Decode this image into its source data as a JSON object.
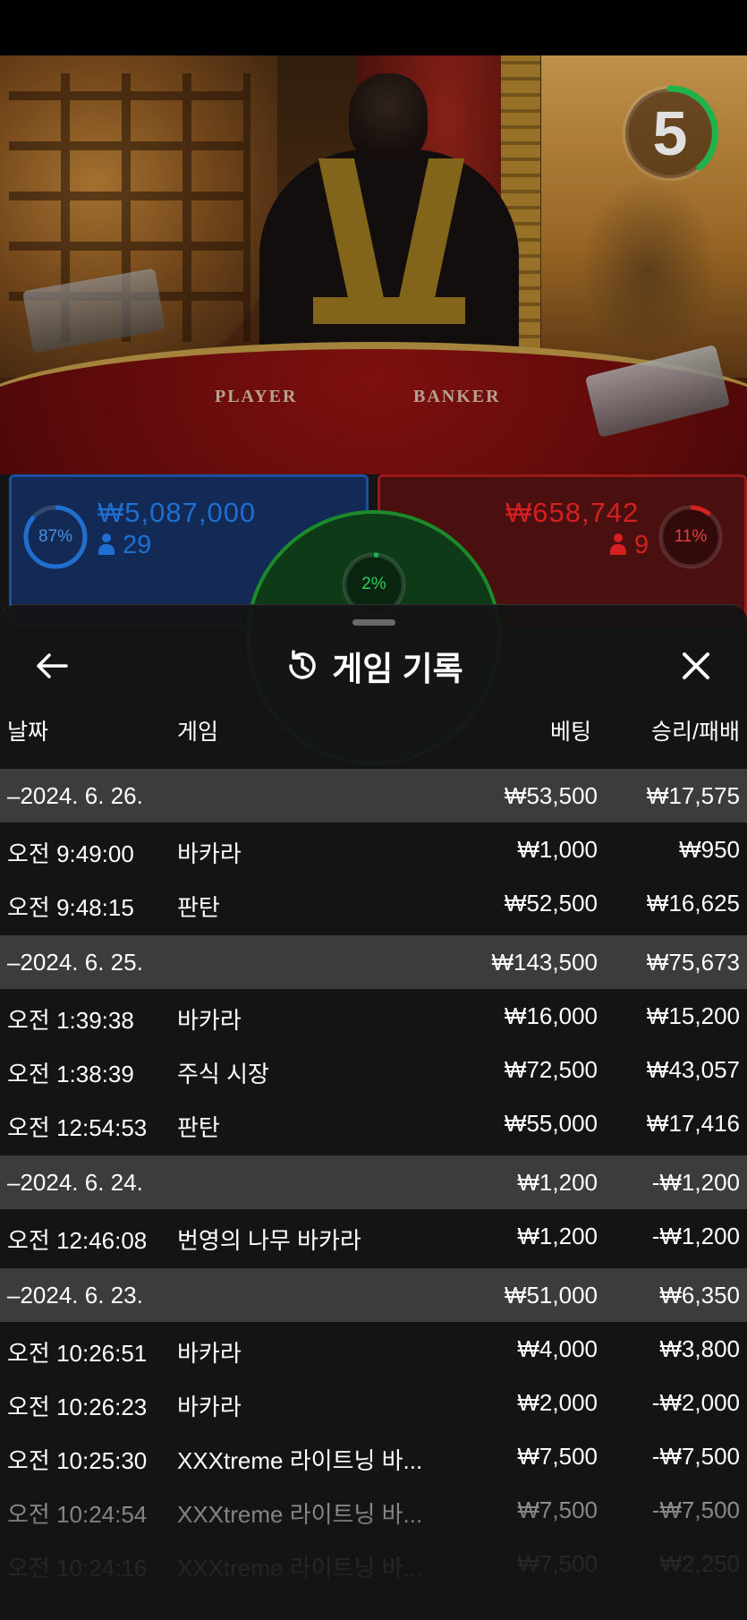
{
  "timer": {
    "value": "5",
    "color": "#1fb34a"
  },
  "bets": {
    "player": {
      "percent": "87%",
      "amount": "₩5,087,000",
      "players": "29",
      "color": "#1f6fd0"
    },
    "banker": {
      "percent": "11%",
      "amount": "₩658,742",
      "players": "9",
      "color": "#d42020"
    },
    "tie": {
      "percent": "2%",
      "color": "#1fb34a"
    }
  },
  "table": {
    "player_label": "PLAYER",
    "banker_label": "BANKER"
  },
  "sheet": {
    "title": "게임 기록",
    "icons": {
      "back": "arrow-left-icon",
      "history": "history-icon",
      "close": "close-icon"
    },
    "headers": {
      "date": "날짜",
      "game": "게임",
      "bet": "베팅",
      "result": "승리/패배"
    },
    "rows": [
      {
        "type": "group",
        "time": "–2024. 6. 26.",
        "game": "",
        "bet": "₩53,500",
        "result": "₩17,575"
      },
      {
        "type": "item",
        "time": "오전 9:49:00",
        "game": "바카라",
        "bet": "₩1,000",
        "result": "₩950"
      },
      {
        "type": "item",
        "time": "오전 9:48:15",
        "game": "판탄",
        "bet": "₩52,500",
        "result": "₩16,625"
      },
      {
        "type": "group",
        "time": "–2024. 6. 25.",
        "game": "",
        "bet": "₩143,500",
        "result": "₩75,673"
      },
      {
        "type": "item",
        "time": "오전 1:39:38",
        "game": "바카라",
        "bet": "₩16,000",
        "result": "₩15,200"
      },
      {
        "type": "item",
        "time": "오전 1:38:39",
        "game": "주식 시장",
        "bet": "₩72,500",
        "result": "₩43,057"
      },
      {
        "type": "item",
        "time": "오전 12:54:53",
        "game": "판탄",
        "bet": "₩55,000",
        "result": "₩17,416"
      },
      {
        "type": "group",
        "time": "–2024. 6. 24.",
        "game": "",
        "bet": "₩1,200",
        "result": "-₩1,200"
      },
      {
        "type": "item",
        "time": "오전 12:46:08",
        "game": "번영의 나무 바카라",
        "bet": "₩1,200",
        "result": "-₩1,200"
      },
      {
        "type": "group",
        "time": "–2024. 6. 23.",
        "game": "",
        "bet": "₩51,000",
        "result": "₩6,350"
      },
      {
        "type": "item",
        "time": "오전 10:26:51",
        "game": "바카라",
        "bet": "₩4,000",
        "result": "₩3,800"
      },
      {
        "type": "item",
        "time": "오전 10:26:23",
        "game": "바카라",
        "bet": "₩2,000",
        "result": "-₩2,000"
      },
      {
        "type": "item",
        "time": "오전 10:25:30",
        "game": "XXXtreme 라이트닝 바...",
        "bet": "₩7,500",
        "result": "-₩7,500"
      },
      {
        "type": "item",
        "time": "오전 10:24:54",
        "game": "XXXtreme 라이트닝 바...",
        "bet": "₩7,500",
        "result": "-₩7,500"
      },
      {
        "type": "item",
        "time": "오전 10:24:16",
        "game": "XXXtreme 라이트닝 바...",
        "bet": "₩7,500",
        "result": "₩2,250"
      }
    ]
  }
}
